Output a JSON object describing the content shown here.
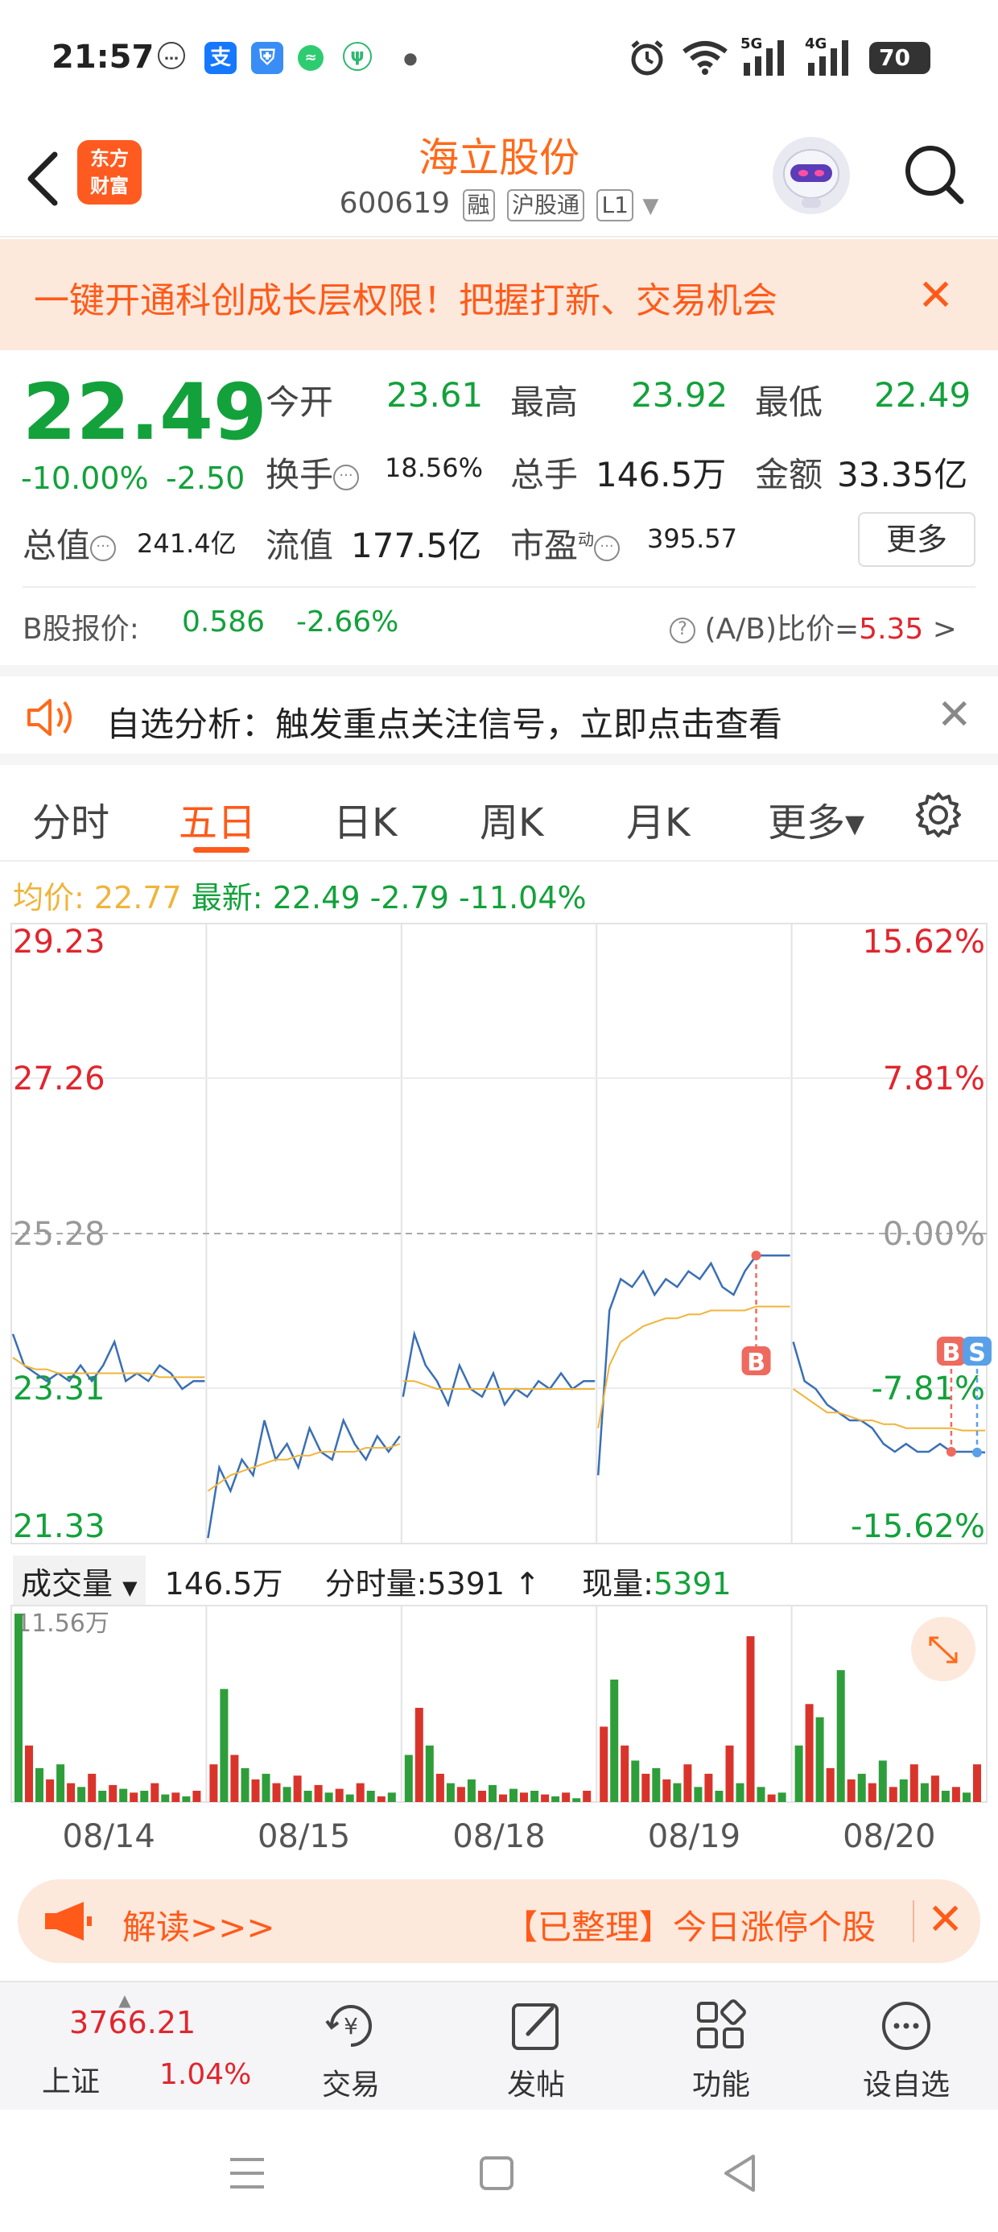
{
  "status_bar": {
    "time": "21:57",
    "network_5g": "5G",
    "network_4g": "4G",
    "battery": "70",
    "app_icons": [
      "message-icon",
      "alipay-icon",
      "shield-icon",
      "chat-icon",
      "plant-icon"
    ]
  },
  "header": {
    "logo_text": "东方\n财富",
    "stock_name": "海立股份",
    "stock_code": "600619",
    "tags": [
      "融",
      "沪股通",
      "L1"
    ]
  },
  "promo": {
    "text": "一键开通科创成长层权限！把握打新、交易机会"
  },
  "quote": {
    "price": "22.49",
    "change_pct": "-10.00%",
    "change": "-2.50",
    "open_label": "今开",
    "open": "23.61",
    "high_label": "最高",
    "high": "23.92",
    "low_label": "最低",
    "low": "22.49",
    "turnover_label": "换手",
    "turnover": "18.56%",
    "volume_label": "总手",
    "volume": "146.5万",
    "amount_label": "金额",
    "amount": "33.35亿",
    "mktcap_label": "总值",
    "mktcap": "241.4亿",
    "float_label": "流值",
    "float": "177.5亿",
    "pe_label": "市盈",
    "pe_sup": "动",
    "pe": "395.57",
    "more_btn": "更多",
    "b_label": "B股报价:",
    "b_price": "0.586",
    "b_change": "-2.66%",
    "ab_label": "(A/B)比价=",
    "ab_value": "5.35",
    "ab_arrow": ">"
  },
  "notice": {
    "text": "自选分析：触发重点关注信号，立即点击查看"
  },
  "tabs": [
    "分时",
    "五日",
    "日K",
    "周K",
    "月K",
    "更多▾"
  ],
  "active_tab": "五日",
  "avg": {
    "avg_label": "均价:",
    "avg_value": "22.77",
    "latest_label": "最新:",
    "latest_value": "22.49",
    "latest_change": "-2.79",
    "latest_pct": "-11.04%"
  },
  "chart_data": {
    "type": "line",
    "y_left_ticks": [
      "29.23",
      "27.26",
      "25.28",
      "23.31",
      "21.33"
    ],
    "y_right_ticks": [
      "15.62%",
      "7.81%",
      "0.00%",
      "-7.81%",
      "-15.62%"
    ],
    "ylim": [
      21.33,
      29.23
    ],
    "prev_close": 25.28,
    "x_dates": [
      "08/14",
      "08/15",
      "08/18",
      "08/19",
      "08/20"
    ],
    "series": [
      {
        "name": "最新",
        "color": "#3a6fb5",
        "days": [
          [
            24.0,
            23.6,
            23.5,
            23.4,
            23.5,
            23.4,
            23.6,
            23.4,
            23.6,
            23.9,
            23.4,
            23.5,
            23.4,
            23.6,
            23.5,
            23.3,
            23.4,
            23.4
          ],
          [
            21.4,
            22.3,
            22.0,
            22.4,
            22.2,
            22.9,
            22.4,
            22.6,
            22.3,
            22.8,
            22.5,
            22.4,
            22.9,
            22.6,
            22.4,
            22.7,
            22.5,
            22.7
          ],
          [
            23.2,
            24.0,
            23.6,
            23.4,
            23.1,
            23.6,
            23.3,
            23.2,
            23.5,
            23.1,
            23.3,
            23.2,
            23.4,
            23.3,
            23.5,
            23.3,
            23.4,
            23.4
          ],
          [
            22.2,
            24.3,
            24.7,
            24.6,
            24.8,
            24.5,
            24.7,
            24.6,
            24.8,
            24.7,
            24.9,
            24.6,
            24.5,
            24.8,
            25.0,
            25.0,
            25.0,
            25.0
          ],
          [
            23.9,
            23.4,
            23.3,
            23.1,
            23.0,
            22.9,
            22.9,
            22.8,
            22.6,
            22.5,
            22.6,
            22.5,
            22.5,
            22.6,
            22.5,
            22.5,
            22.5,
            22.49
          ]
        ]
      },
      {
        "name": "均价",
        "color": "#f0b43a",
        "days": [
          [
            23.7,
            23.6,
            23.55,
            23.55,
            23.5,
            23.5,
            23.5,
            23.5,
            23.5,
            23.5,
            23.5,
            23.5,
            23.5,
            23.45,
            23.45,
            23.45,
            23.45,
            23.45
          ],
          [
            22.0,
            22.1,
            22.2,
            22.25,
            22.3,
            22.35,
            22.4,
            22.4,
            22.45,
            22.45,
            22.5,
            22.5,
            22.5,
            22.5,
            22.55,
            22.55,
            22.55,
            22.6
          ],
          [
            23.4,
            23.4,
            23.35,
            23.3,
            23.3,
            23.3,
            23.3,
            23.3,
            23.3,
            23.3,
            23.3,
            23.3,
            23.3,
            23.3,
            23.3,
            23.3,
            23.3,
            23.3
          ],
          [
            22.8,
            23.6,
            23.9,
            24.0,
            24.1,
            24.15,
            24.2,
            24.2,
            24.25,
            24.25,
            24.3,
            24.3,
            24.3,
            24.3,
            24.35,
            24.35,
            24.35,
            24.35
          ],
          [
            23.3,
            23.2,
            23.1,
            23.0,
            23.0,
            22.95,
            22.9,
            22.9,
            22.85,
            22.85,
            22.8,
            22.8,
            22.8,
            22.8,
            22.8,
            22.77,
            22.77,
            22.77
          ]
        ]
      }
    ],
    "markers": [
      {
        "label": "B",
        "day": 3,
        "color": "#ee6a5f"
      },
      {
        "label": "B",
        "day": 4,
        "color": "#ee6a5f"
      },
      {
        "label": "S",
        "day": 4,
        "color": "#5aa0e8"
      }
    ],
    "volume_max_label": "11.56万",
    "volume_days": [
      [
        100,
        30,
        18,
        12,
        20,
        10,
        8,
        15,
        6,
        9,
        7,
        5,
        6,
        10,
        4,
        5,
        3,
        6
      ],
      [
        20,
        60,
        25,
        18,
        12,
        15,
        10,
        8,
        14,
        6,
        9,
        5,
        7,
        4,
        10,
        6,
        3,
        5
      ],
      [
        25,
        50,
        30,
        15,
        10,
        8,
        12,
        6,
        9,
        4,
        7,
        5,
        6,
        4,
        3,
        5,
        2,
        6
      ],
      [
        40,
        65,
        30,
        22,
        15,
        18,
        12,
        10,
        20,
        8,
        15,
        6,
        30,
        10,
        88,
        8,
        4,
        5
      ],
      [
        30,
        52,
        45,
        18,
        70,
        12,
        15,
        10,
        22,
        8,
        12,
        20,
        10,
        14,
        6,
        8,
        5,
        20
      ]
    ]
  },
  "volume_bar": {
    "selector": "成交量",
    "total": "146.5万",
    "tick_label": "分时量:",
    "tick_value": "5391",
    "tick_arrow": "↑",
    "now_label": "现量:",
    "now_value": "5391"
  },
  "ticker": {
    "text1": "解读>>>",
    "text2": "【已整理】今日涨停个股"
  },
  "bottom_nav": {
    "index_value": "3766.21",
    "index_name": "上证",
    "index_pct": "1.04%",
    "items": [
      "交易",
      "发帖",
      "功能",
      "设自选"
    ]
  }
}
